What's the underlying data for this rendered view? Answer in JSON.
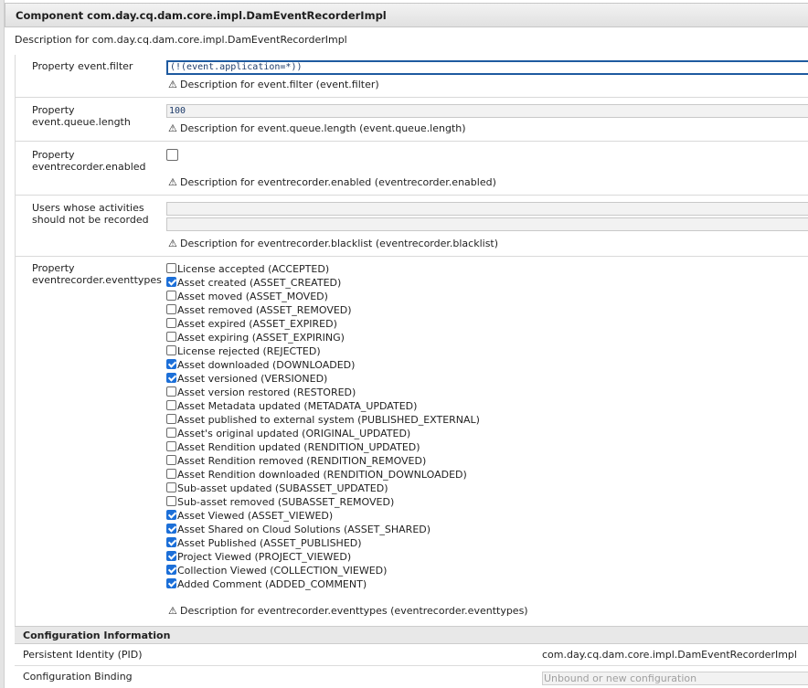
{
  "component_title": "Component com.day.cq.dam.core.impl.DamEventRecorderImpl",
  "component_description": "Description for com.day.cq.dam.core.impl.DamEventRecorderImpl",
  "properties": {
    "event_filter": {
      "label": "Property event.filter",
      "value": "(!(event.application=*))",
      "description": "Description for event.filter (event.filter)"
    },
    "queue_length": {
      "label_line1": "Property",
      "label_line2": "event.queue.length",
      "value": "100",
      "description": "Description for event.queue.length (event.queue.length)"
    },
    "enabled": {
      "label_line1": "Property",
      "label_line2": "eventrecorder.enabled",
      "checked": false,
      "description": "Description for eventrecorder.enabled (eventrecorder.enabled)"
    },
    "blacklist": {
      "label_line1": "Users whose activities",
      "label_line2": "should not be recorded",
      "values": [
        "",
        ""
      ],
      "description": "Description for eventrecorder.blacklist (eventrecorder.blacklist)"
    },
    "eventtypes": {
      "label_line1": "Property",
      "label_line2": "eventrecorder.eventtypes",
      "description": "Description for eventrecorder.eventtypes (eventrecorder.eventtypes)",
      "items": [
        {
          "label": "License accepted (ACCEPTED)",
          "checked": false
        },
        {
          "label": "Asset created (ASSET_CREATED)",
          "checked": true
        },
        {
          "label": "Asset moved (ASSET_MOVED)",
          "checked": false
        },
        {
          "label": "Asset removed (ASSET_REMOVED)",
          "checked": false
        },
        {
          "label": "Asset expired (ASSET_EXPIRED)",
          "checked": false
        },
        {
          "label": "Asset expiring (ASSET_EXPIRING)",
          "checked": false
        },
        {
          "label": "License rejected (REJECTED)",
          "checked": false
        },
        {
          "label": "Asset downloaded (DOWNLOADED)",
          "checked": true
        },
        {
          "label": "Asset versioned (VERSIONED)",
          "checked": true
        },
        {
          "label": "Asset version restored (RESTORED)",
          "checked": false
        },
        {
          "label": "Asset Metadata updated (METADATA_UPDATED)",
          "checked": false
        },
        {
          "label": "Asset published to external system (PUBLISHED_EXTERNAL)",
          "checked": false
        },
        {
          "label": "Asset's original updated (ORIGINAL_UPDATED)",
          "checked": false
        },
        {
          "label": "Asset Rendition updated (RENDITION_UPDATED)",
          "checked": false
        },
        {
          "label": "Asset Rendition removed (RENDITION_REMOVED)",
          "checked": false
        },
        {
          "label": "Asset Rendition downloaded (RENDITION_DOWNLOADED)",
          "checked": false
        },
        {
          "label": "Sub-asset updated (SUBASSET_UPDATED)",
          "checked": false
        },
        {
          "label": "Sub-asset removed (SUBASSET_REMOVED)",
          "checked": false
        },
        {
          "label": "Asset Viewed (ASSET_VIEWED)",
          "checked": true
        },
        {
          "label": "Asset Shared on Cloud Solutions (ASSET_SHARED)",
          "checked": true
        },
        {
          "label": "Asset Published (ASSET_PUBLISHED)",
          "checked": true
        },
        {
          "label": "Project Viewed (PROJECT_VIEWED)",
          "checked": true
        },
        {
          "label": "Collection Viewed (COLLECTION_VIEWED)",
          "checked": true
        },
        {
          "label": "Added Comment (ADDED_COMMENT)",
          "checked": true
        }
      ]
    }
  },
  "configuration": {
    "title": "Configuration Information",
    "pid_label": "Persistent Identity (PID)",
    "pid_value": "com.day.cq.dam.core.impl.DamEventRecorderImpl",
    "binding_label": "Configuration Binding",
    "binding_placeholder": "Unbound or new configuration"
  },
  "icons": {
    "warning": "warning-icon"
  },
  "colors": {
    "checkbox_checked": "#1c6fd8",
    "focus_border": "#1e5aa0"
  }
}
